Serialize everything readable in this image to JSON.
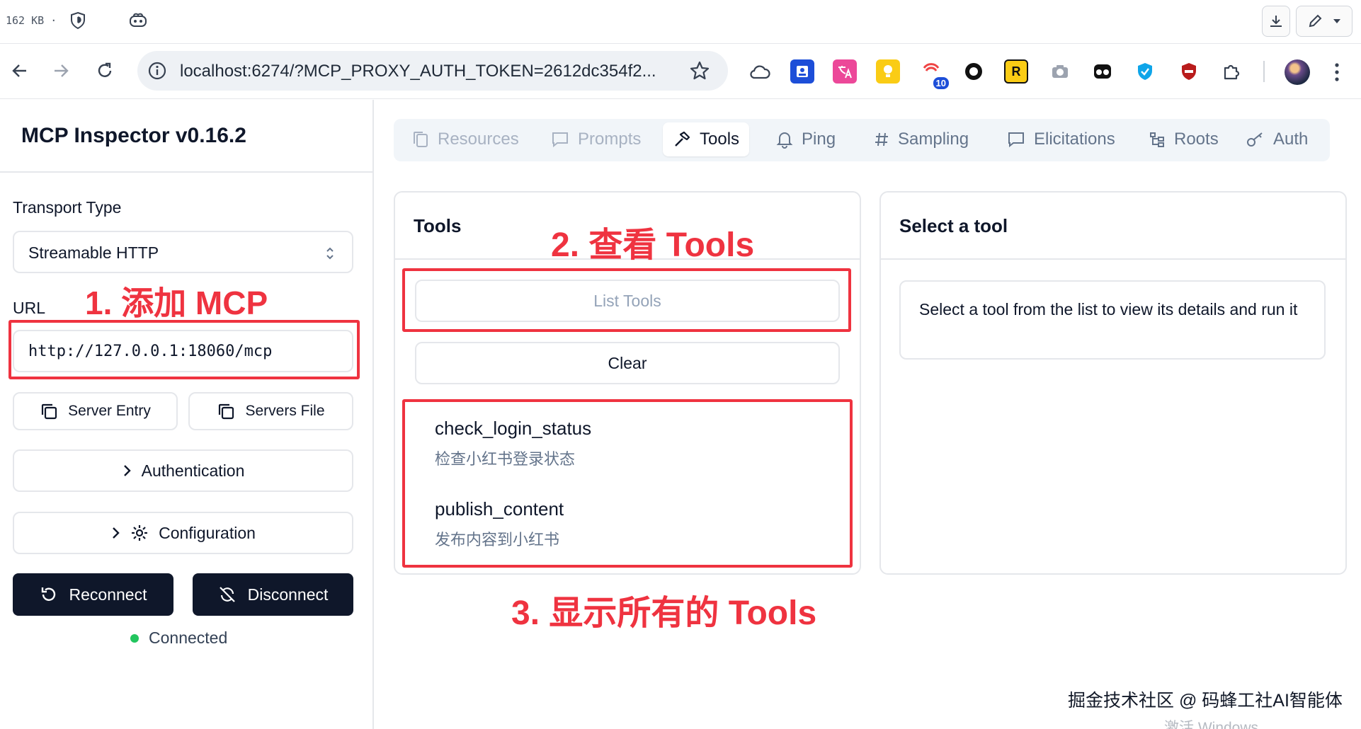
{
  "download_bar": {
    "file_size": "162 KB ·"
  },
  "browser": {
    "address": "localhost:6274/?MCP_PROXY_AUTH_TOKEN=2612dc354f2...",
    "ext_badge": "10",
    "ext_letter": "R"
  },
  "sidebar": {
    "title": "MCP Inspector v0.16.2",
    "transport_label": "Transport Type",
    "transport_value": "Streamable HTTP",
    "url_label": "URL",
    "url_value": "http://127.0.0.1:18060/mcp",
    "server_entry": "Server Entry",
    "servers_file": "Servers File",
    "authentication": "Authentication",
    "configuration": "Configuration",
    "reconnect": "Reconnect",
    "disconnect": "Disconnect",
    "status": "Connected"
  },
  "tabs": [
    {
      "label": "Resources"
    },
    {
      "label": "Prompts"
    },
    {
      "label": "Tools"
    },
    {
      "label": "Ping"
    },
    {
      "label": "Sampling"
    },
    {
      "label": "Elicitations"
    },
    {
      "label": "Roots"
    },
    {
      "label": "Auth"
    }
  ],
  "tools_panel": {
    "title": "Tools",
    "list_button": "List Tools",
    "clear_button": "Clear",
    "items": [
      {
        "name": "check_login_status",
        "desc": "检查小红书登录状态"
      },
      {
        "name": "publish_content",
        "desc": "发布内容到小红书"
      }
    ]
  },
  "detail_panel": {
    "title": "Select a tool",
    "hint": "Select a tool from the list to view its details and run it"
  },
  "annotations": {
    "step1": "1. 添加 MCP",
    "step2": "2. 查看 Tools",
    "step3": "3. 显示所有的 Tools"
  },
  "watermark": {
    "credit": "掘金技术社区 @ 码蜂工社AI智能体",
    "activate": "激活 Windows"
  },
  "colors": {
    "accent_dark": "#0f172a",
    "annotation_red": "#ef3340",
    "status_green": "#22c55e"
  }
}
